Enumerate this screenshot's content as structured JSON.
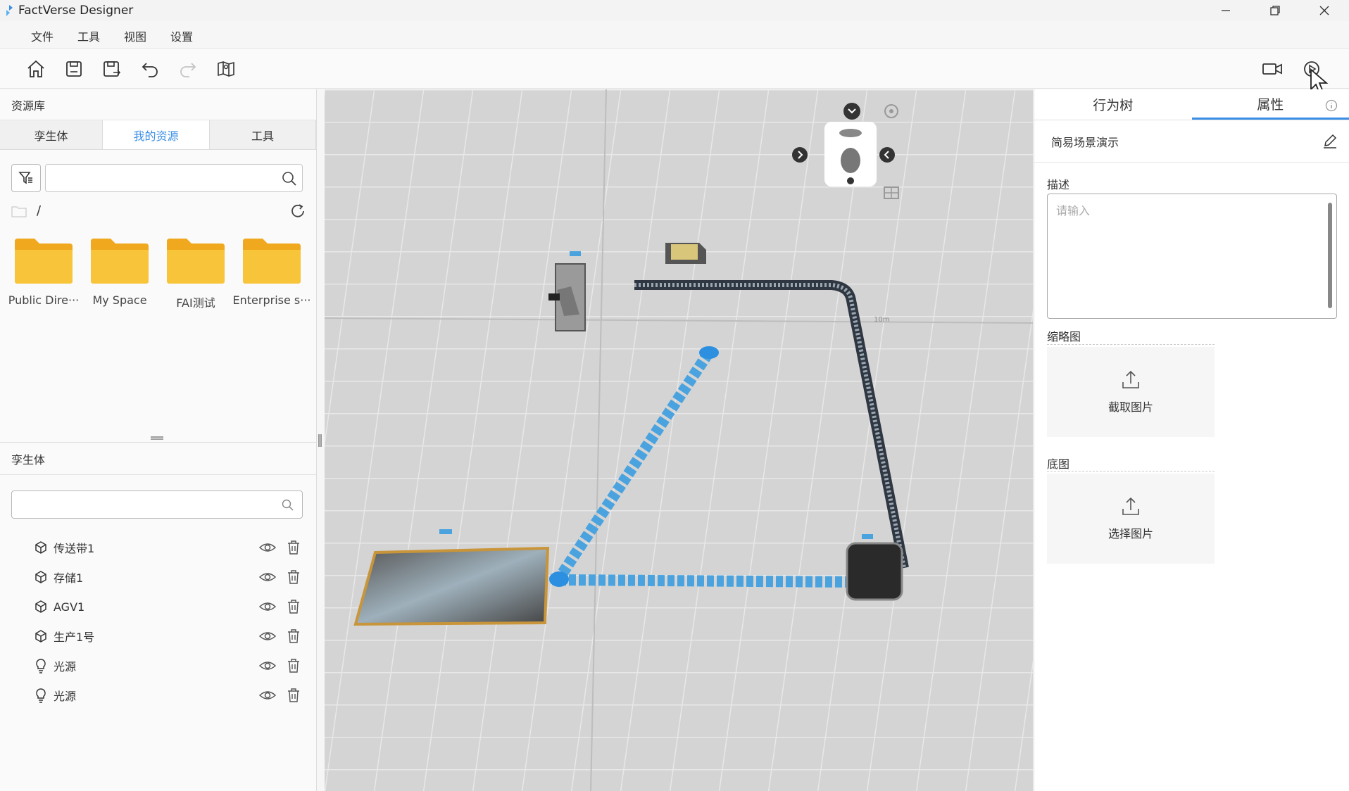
{
  "app": {
    "title": "FactVerse Designer"
  },
  "menu": {
    "items": [
      "文件",
      "工具",
      "视图",
      "设置"
    ]
  },
  "left": {
    "library_title": "资源库",
    "tabs": [
      "孪生体",
      "我的资源",
      "工具"
    ],
    "active_tab": "我的资源",
    "search_value": "",
    "path": "/",
    "folders": [
      "Public Dire···",
      "My Space",
      "FAI测试",
      "Enterprise s···"
    ],
    "twins_title": "孪生体",
    "twins_search_value": "",
    "twins": [
      {
        "label": "传送带1",
        "icon": "cube-icon"
      },
      {
        "label": "存储1",
        "icon": "cube-icon"
      },
      {
        "label": "AGV1",
        "icon": "cube-icon"
      },
      {
        "label": "生产1号",
        "icon": "cube-icon"
      },
      {
        "label": "光源",
        "icon": "bulb-icon"
      },
      {
        "label": "光源",
        "icon": "bulb-icon"
      }
    ]
  },
  "viewport": {
    "scale_label": "10m"
  },
  "right": {
    "tabs": [
      "行为树",
      "属性"
    ],
    "active_tab": "属性",
    "scene_name": "简易场景演示",
    "description_label": "描述",
    "description_placeholder": "请输入",
    "thumbnail_label": "缩略图",
    "thumbnail_button": "截取图片",
    "basemap_label": "底图",
    "basemap_button": "选择图片"
  },
  "colors": {
    "accent": "#3a8ee6",
    "folder": "#f5b82a",
    "path": "#4aa3df"
  }
}
